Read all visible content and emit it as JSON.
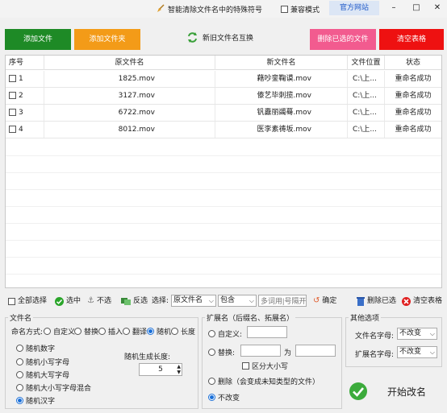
{
  "titlebar": {
    "title": "智能清除文件名中的特殊符号",
    "compat_label": "兼容模式",
    "site_label": "官方网站",
    "minimize": "–",
    "maximize": "□",
    "close": "✕"
  },
  "top_buttons": {
    "add_file": "添加文件",
    "add_folder": "添加文件夹",
    "swap": "新旧文件名互换",
    "delete_selected": "删除已选的文件",
    "clear_table": "清空表格"
  },
  "colors": {
    "add_file": "#1e8a26",
    "add_folder": "#f39b18",
    "delete_selected": "#f25b8f",
    "clear_table": "#ee1111",
    "accent": "#1a6fd8"
  },
  "table": {
    "headers": [
      "序号",
      "原文件名",
      "新文件名",
      "文件位置",
      "状态"
    ],
    "rows": [
      {
        "index": "1",
        "original": "1825.mov",
        "new": "藉吵銮鞠谟.mov",
        "location": "C:\\上...",
        "status": "重命名成功"
      },
      {
        "index": "2",
        "original": "3127.mov",
        "new": "傣艺毕刺揽.mov",
        "location": "C:\\上...",
        "status": "重命名成功"
      },
      {
        "index": "3",
        "original": "6722.mov",
        "new": "钒纛丽蠲蓦.mov",
        "location": "C:\\上...",
        "status": "重命名成功"
      },
      {
        "index": "4",
        "original": "8012.mov",
        "new": "医李素祷坂.mov",
        "location": "C:\\上...",
        "status": "重命名成功"
      }
    ]
  },
  "toolbar": {
    "select_all": "全部选择",
    "select_checked": "选中",
    "select_none": "不选",
    "invert": "反选",
    "select_label": "选择:",
    "field_value": "原文件名",
    "match_value": "包含",
    "multi_placeholder": "多词用|号隔开",
    "confirm": "确定",
    "delete_selected": "删除已选",
    "clear_table": "清空表格"
  },
  "filename_group": {
    "title": "文件名",
    "mode_label": "命名方式:",
    "modes": [
      "自定义",
      "替换",
      "插入",
      "翻译",
      "随机",
      "长度"
    ],
    "selected_mode": "随机",
    "random_options": [
      "随机数字",
      "随机小写字母",
      "随机大写字母",
      "随机大小写字母混合",
      "随机汉字"
    ],
    "selected_random": "随机汉字",
    "length_label": "随机生成长度:",
    "length_value": "5"
  },
  "ext_group": {
    "title": "扩展名（后缀名、拓展名）",
    "custom": "自定义:",
    "replace": "替换:",
    "replace_with": "为",
    "case_sensitive": "区分大小写",
    "delete": "删除（会变成未知类型的文件）",
    "unchanged": "不改变",
    "selected": "不改变"
  },
  "other_group": {
    "title": "其他选项",
    "filename_case_label": "文件名字母:",
    "filename_case_value": "不改变",
    "ext_case_label": "扩展名字母:",
    "ext_case_value": "不改变"
  },
  "start_button": "开始改名"
}
